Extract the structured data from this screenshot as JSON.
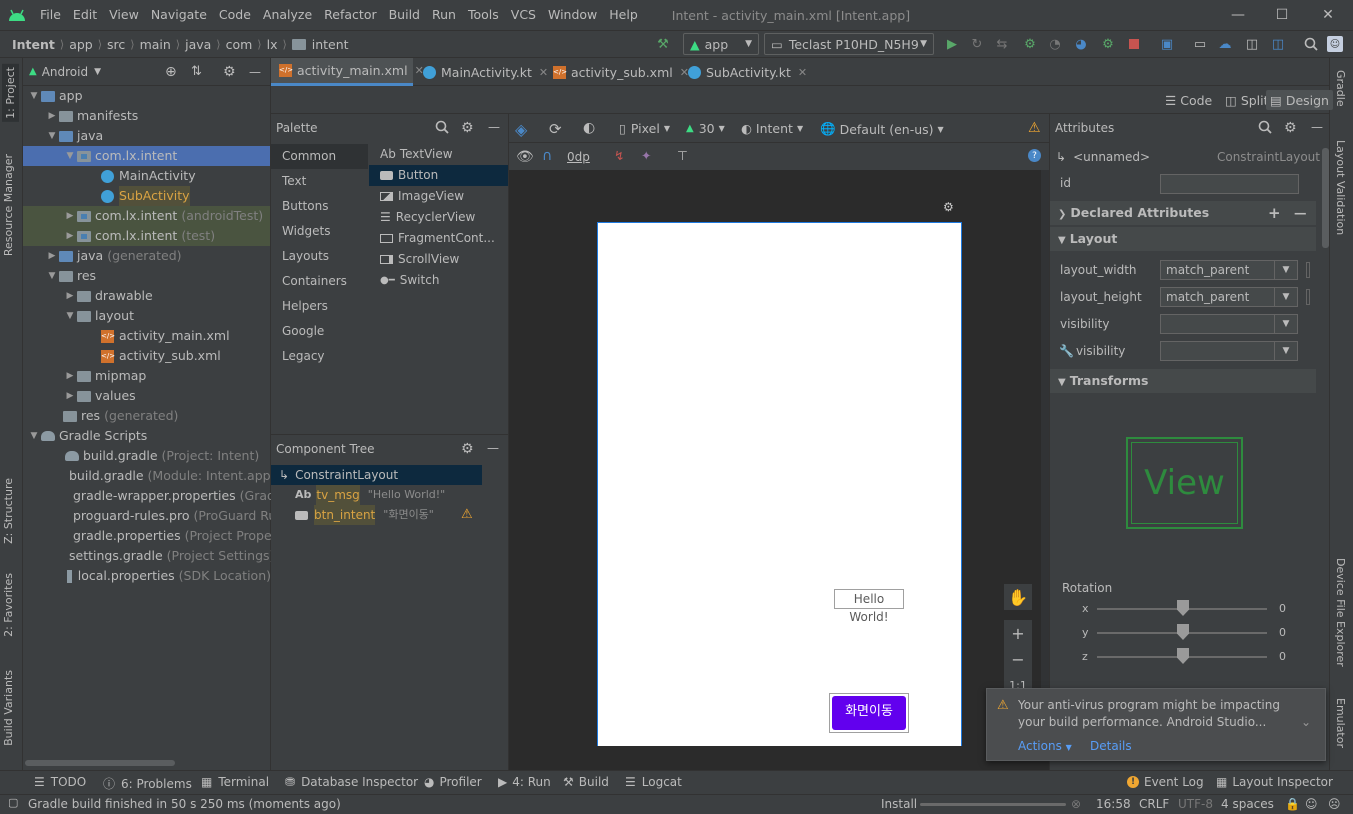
{
  "menu": [
    "File",
    "Edit",
    "View",
    "Navigate",
    "Code",
    "Analyze",
    "Refactor",
    "Build",
    "Run",
    "Tools",
    "VCS",
    "Window",
    "Help"
  ],
  "window_title": "Intent - activity_main.xml [Intent.app]",
  "breadcrumb": [
    "Intent",
    "app",
    "src",
    "main",
    "java",
    "com",
    "lx",
    "intent"
  ],
  "toolbar": {
    "config": "app",
    "device": "Teclast P10HD_N5H9"
  },
  "left_strip": {
    "project": "1: Project",
    "resource_manager": "Resource Manager",
    "structure": "Z: Structure",
    "favorites": "2: Favorites",
    "build_variants": "Build Variants"
  },
  "right_strip": {
    "gradle": "Gradle",
    "layout_validation": "Layout Validation",
    "device_file_explorer": "Device File Explorer",
    "emulator": "Emulator"
  },
  "project": {
    "view": "Android",
    "tree": [
      {
        "label": "app"
      },
      {
        "label": "manifests"
      },
      {
        "label": "java"
      },
      {
        "label": "com.lx.intent"
      },
      {
        "label": "MainActivity"
      },
      {
        "label": "SubActivity"
      },
      {
        "label": "com.lx.intent",
        "hint": "(androidTest)"
      },
      {
        "label": "com.lx.intent",
        "hint": "(test)"
      },
      {
        "label": "java",
        "hint": "(generated)"
      },
      {
        "label": "res"
      },
      {
        "label": "drawable"
      },
      {
        "label": "layout"
      },
      {
        "label": "activity_main.xml"
      },
      {
        "label": "activity_sub.xml"
      },
      {
        "label": "mipmap"
      },
      {
        "label": "values"
      },
      {
        "label": "res",
        "hint": "(generated)"
      },
      {
        "label": "Gradle Scripts"
      },
      {
        "label": "build.gradle",
        "hint": "(Project: Intent)"
      },
      {
        "label": "build.gradle",
        "hint": "(Module: Intent.app)"
      },
      {
        "label": "gradle-wrapper.properties",
        "hint": "(Gradle Version)"
      },
      {
        "label": "proguard-rules.pro",
        "hint": "(ProGuard Rules for Intent.app)"
      },
      {
        "label": "gradle.properties",
        "hint": "(Project Properties)"
      },
      {
        "label": "settings.gradle",
        "hint": "(Project Settings)"
      },
      {
        "label": "local.properties",
        "hint": "(SDK Location)"
      }
    ]
  },
  "tabs": [
    "activity_main.xml",
    "MainActivity.kt",
    "activity_sub.xml",
    "SubActivity.kt"
  ],
  "modes": [
    "Code",
    "Split",
    "Design"
  ],
  "palette": {
    "title": "Palette",
    "categories": [
      "Common",
      "Text",
      "Buttons",
      "Widgets",
      "Layouts",
      "Containers",
      "Helpers",
      "Google",
      "Legacy"
    ],
    "items": [
      {
        "prefix": "Ab",
        "label": "TextView"
      },
      {
        "label": "Button"
      },
      {
        "label": "ImageView"
      },
      {
        "label": "RecyclerView"
      },
      {
        "label": "FragmentCont..."
      },
      {
        "label": "ScrollView"
      },
      {
        "label": "Switch"
      }
    ]
  },
  "component_tree": {
    "title": "Component Tree",
    "root": "ConstraintLayout",
    "children": [
      {
        "prefix": "Ab",
        "id": "tv_msg",
        "text": "\"Hello World!\""
      },
      {
        "id": "btn_intent",
        "text": "\"화면이동\""
      }
    ]
  },
  "design_toolbar": {
    "device": "Pixel",
    "api": "30",
    "theme": "Intent",
    "locale": "Default (en-us)",
    "margin": "0dp"
  },
  "preview": {
    "textview": "Hello World!",
    "button": "화면이동",
    "zoom_fit": "1:1"
  },
  "attributes": {
    "title": "Attributes",
    "component": "<unnamed>",
    "component_type": "ConstraintLayout",
    "id_label": "id",
    "declared": "Declared Attributes",
    "layout_section": "Layout",
    "layout_width_label": "layout_width",
    "layout_width": "match_parent",
    "layout_height_label": "layout_height",
    "layout_height": "match_parent",
    "visibility_label": "visibility",
    "tools_visibility_label": "visibility",
    "transforms": "Transforms",
    "view_label": "View",
    "rotation": "Rotation",
    "rot_x_label": "x",
    "rot_x": "0",
    "rot_y_label": "y",
    "rot_y": "0",
    "rot_z_label": "z",
    "rot_z": "0"
  },
  "notification": {
    "message": "Your anti-virus program might be impacting your build performance. Android Studio...",
    "actions": "Actions",
    "details": "Details"
  },
  "bottom_tools": {
    "todo": "TODO",
    "problems": "6: Problems",
    "terminal": "Terminal",
    "database": "Database Inspector",
    "profiler": "Profiler",
    "run": "4: Run",
    "build": "Build",
    "logcat": "Logcat",
    "event_log": "Event Log",
    "layout_inspector": "Layout Inspector"
  },
  "status": {
    "message": "Gradle build finished in 50 s 250 ms (moments ago)",
    "install": "Install",
    "time": "16:58",
    "line_sep": "CRLF",
    "encoding": "UTF-8",
    "indent": "4 spaces"
  },
  "colors": {
    "accent": "#4b6eaf",
    "button": "#6200ee",
    "warning": "#f0a732",
    "run": "#59a869"
  }
}
